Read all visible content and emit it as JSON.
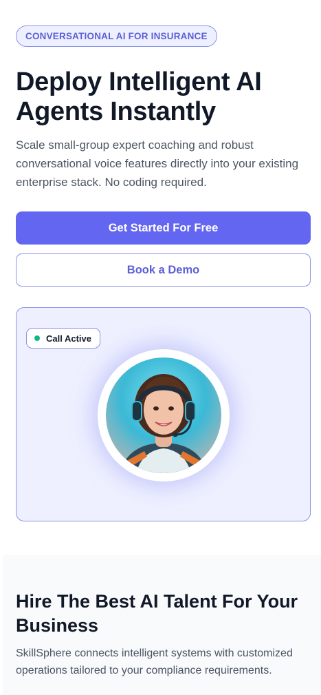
{
  "hero": {
    "badge": "CONVERSATIONAL AI FOR INSURANCE",
    "title": "Deploy Intelligent AI Agents Instantly",
    "subtitle": "Scale small-group expert coaching and robust conversational voice features directly into your existing enterprise stack. No coding required.",
    "primary_button": "Get Started For Free",
    "secondary_button": "Book a Demo"
  },
  "call_card": {
    "status": "Call Active",
    "status_color": "#10b981",
    "avatar_icon": "agent-headset-avatar"
  },
  "section2": {
    "title": "Hire The Best AI Talent For Your Business",
    "text": "SkillSphere connects intelligent systems with customized operations tailored to your compliance requirements."
  },
  "colors": {
    "accent": "#6366f1",
    "accent_text": "#5b5fd6",
    "card_bg": "#eef0ff",
    "heading": "#111827"
  }
}
